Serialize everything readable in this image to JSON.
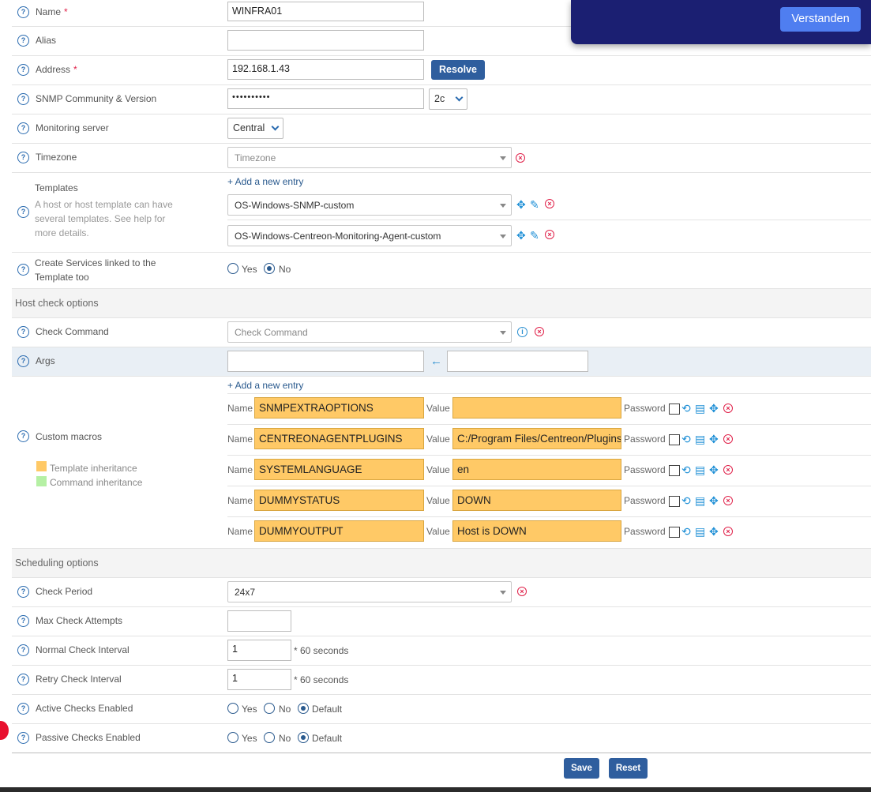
{
  "toast": {
    "button_label": "Verstanden"
  },
  "fields": {
    "name": {
      "label": "Name",
      "required": "*",
      "value": "WINFRA01"
    },
    "alias": {
      "label": "Alias",
      "value": ""
    },
    "address": {
      "label": "Address",
      "required": "*",
      "value": "192.168.1.43",
      "resolve_label": "Resolve"
    },
    "snmp": {
      "label": "SNMP Community & Version",
      "community": "••••••••••",
      "version": "2c"
    },
    "monitoring_server": {
      "label": "Monitoring server",
      "value": "Central"
    },
    "timezone": {
      "label": "Timezone",
      "placeholder": "Timezone"
    },
    "templates": {
      "label": "Templates",
      "description": "A host or host template can have several templates. See help for more details.",
      "add_label": "+ Add a new entry",
      "items": [
        "OS-Windows-SNMP-custom",
        "OS-Windows-Centreon-Monitoring-Agent-custom"
      ]
    },
    "create_services": {
      "label_line1": "Create Services linked to the",
      "label_line2": "Template too",
      "yes": "Yes",
      "no": "No",
      "selected": "No"
    }
  },
  "host_check": {
    "section_title": "Host check options",
    "check_command": {
      "label": "Check Command",
      "placeholder": "Check Command"
    },
    "args": {
      "label": "Args",
      "arrow": "←"
    },
    "macros": {
      "label": "Custom macros",
      "add_label": "+ Add a new entry",
      "name_label": "Name",
      "value_label": "Value",
      "password_label": "Password",
      "items": [
        {
          "name": "SNMPEXTRAOPTIONS",
          "value": ""
        },
        {
          "name": "CENTREONAGENTPLUGINS",
          "value": "C:/Program Files/Centreon/Plugins"
        },
        {
          "name": "SYSTEMLANGUAGE",
          "value": "en"
        },
        {
          "name": "DUMMYSTATUS",
          "value": "DOWN"
        },
        {
          "name": "DUMMYOUTPUT",
          "value": "Host is DOWN"
        }
      ],
      "legend": [
        {
          "label": "Template inheritance",
          "color": "#ffc966"
        },
        {
          "label": "Command inheritance",
          "color": "#b5f0a4"
        }
      ]
    }
  },
  "scheduling": {
    "section_title": "Scheduling options",
    "check_period": {
      "label": "Check Period",
      "value": "24x7"
    },
    "max_check_attempts": {
      "label": "Max Check Attempts",
      "value": ""
    },
    "normal_interval": {
      "label": "Normal Check Interval",
      "value": "1",
      "unit": "* 60 seconds"
    },
    "retry_interval": {
      "label": "Retry Check Interval",
      "value": "1",
      "unit": "* 60 seconds"
    },
    "active_checks": {
      "label": "Active Checks Enabled",
      "yes": "Yes",
      "no": "No",
      "default": "Default",
      "selected": "Default"
    },
    "passive_checks": {
      "label": "Passive Checks Enabled",
      "yes": "Yes",
      "no": "No",
      "default": "Default",
      "selected": "Default"
    }
  },
  "footer": {
    "save_label": "Save",
    "reset_label": "Reset"
  },
  "icons": {
    "help": "question-circle-icon",
    "delete": "circle-x-icon",
    "move": "move-arrows-icon",
    "edit": "pencil-icon",
    "info": "info-icon",
    "undo": "undo-icon",
    "notes": "notes-icon"
  }
}
